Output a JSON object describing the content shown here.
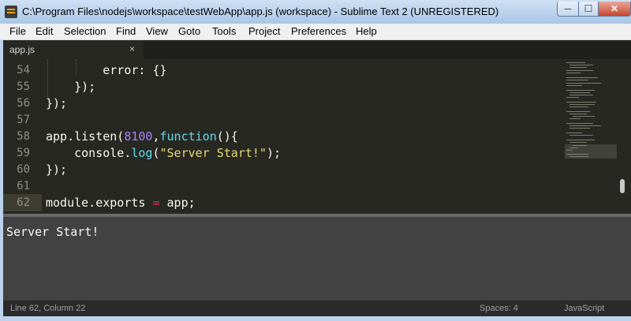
{
  "window": {
    "title": "C:\\Program Files\\nodejs\\workspace\\testWebApp\\app.js (workspace) - Sublime Text 2 (UNREGISTERED)",
    "controls": {
      "minimize": "─",
      "maximize": "☐",
      "close": "✕"
    }
  },
  "menu": [
    "File",
    "Edit",
    "Selection",
    "Find",
    "View",
    "Goto",
    "Tools",
    "Project",
    "Preferences",
    "Help"
  ],
  "tabs": [
    {
      "label": "app.js",
      "close": "×"
    }
  ],
  "editor": {
    "lines": [
      {
        "num": "54",
        "code": "        error: {}"
      },
      {
        "num": "55",
        "code": "    });"
      },
      {
        "num": "56",
        "code": "});"
      },
      {
        "num": "57",
        "code": ""
      },
      {
        "num": "58",
        "code": "app.listen(8100,function(){"
      },
      {
        "num": "59",
        "code": "    console.log(\"Server Start!\");"
      },
      {
        "num": "60",
        "code": "});"
      },
      {
        "num": "61",
        "code": ""
      },
      {
        "num": "62",
        "code": "module.exports = app;"
      }
    ],
    "current_line": "62"
  },
  "console": {
    "output": "Server Start!"
  },
  "status": {
    "position": "Line 62, Column 22",
    "indentation": "Spaces: 4",
    "syntax": "JavaScript"
  },
  "colors": {
    "editor_bg": "#272822",
    "keyword": "#66d9ef",
    "number": "#ae81ff",
    "string": "#e6db74",
    "operator": "#f92672"
  }
}
